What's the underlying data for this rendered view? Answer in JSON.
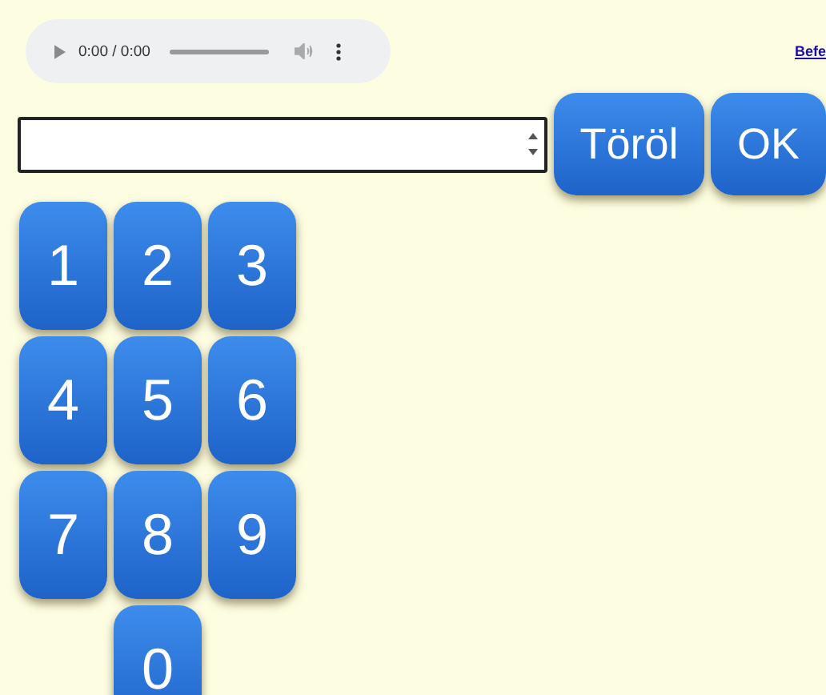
{
  "audio_player": {
    "time": "0:00 / 0:00"
  },
  "link": "Befe",
  "buttons": [
    "Töröl",
    "OK"
  ],
  "keypad": [
    "1",
    "2",
    "3",
    "4",
    "5",
    "6",
    "7",
    "8",
    "9",
    "0"
  ]
}
